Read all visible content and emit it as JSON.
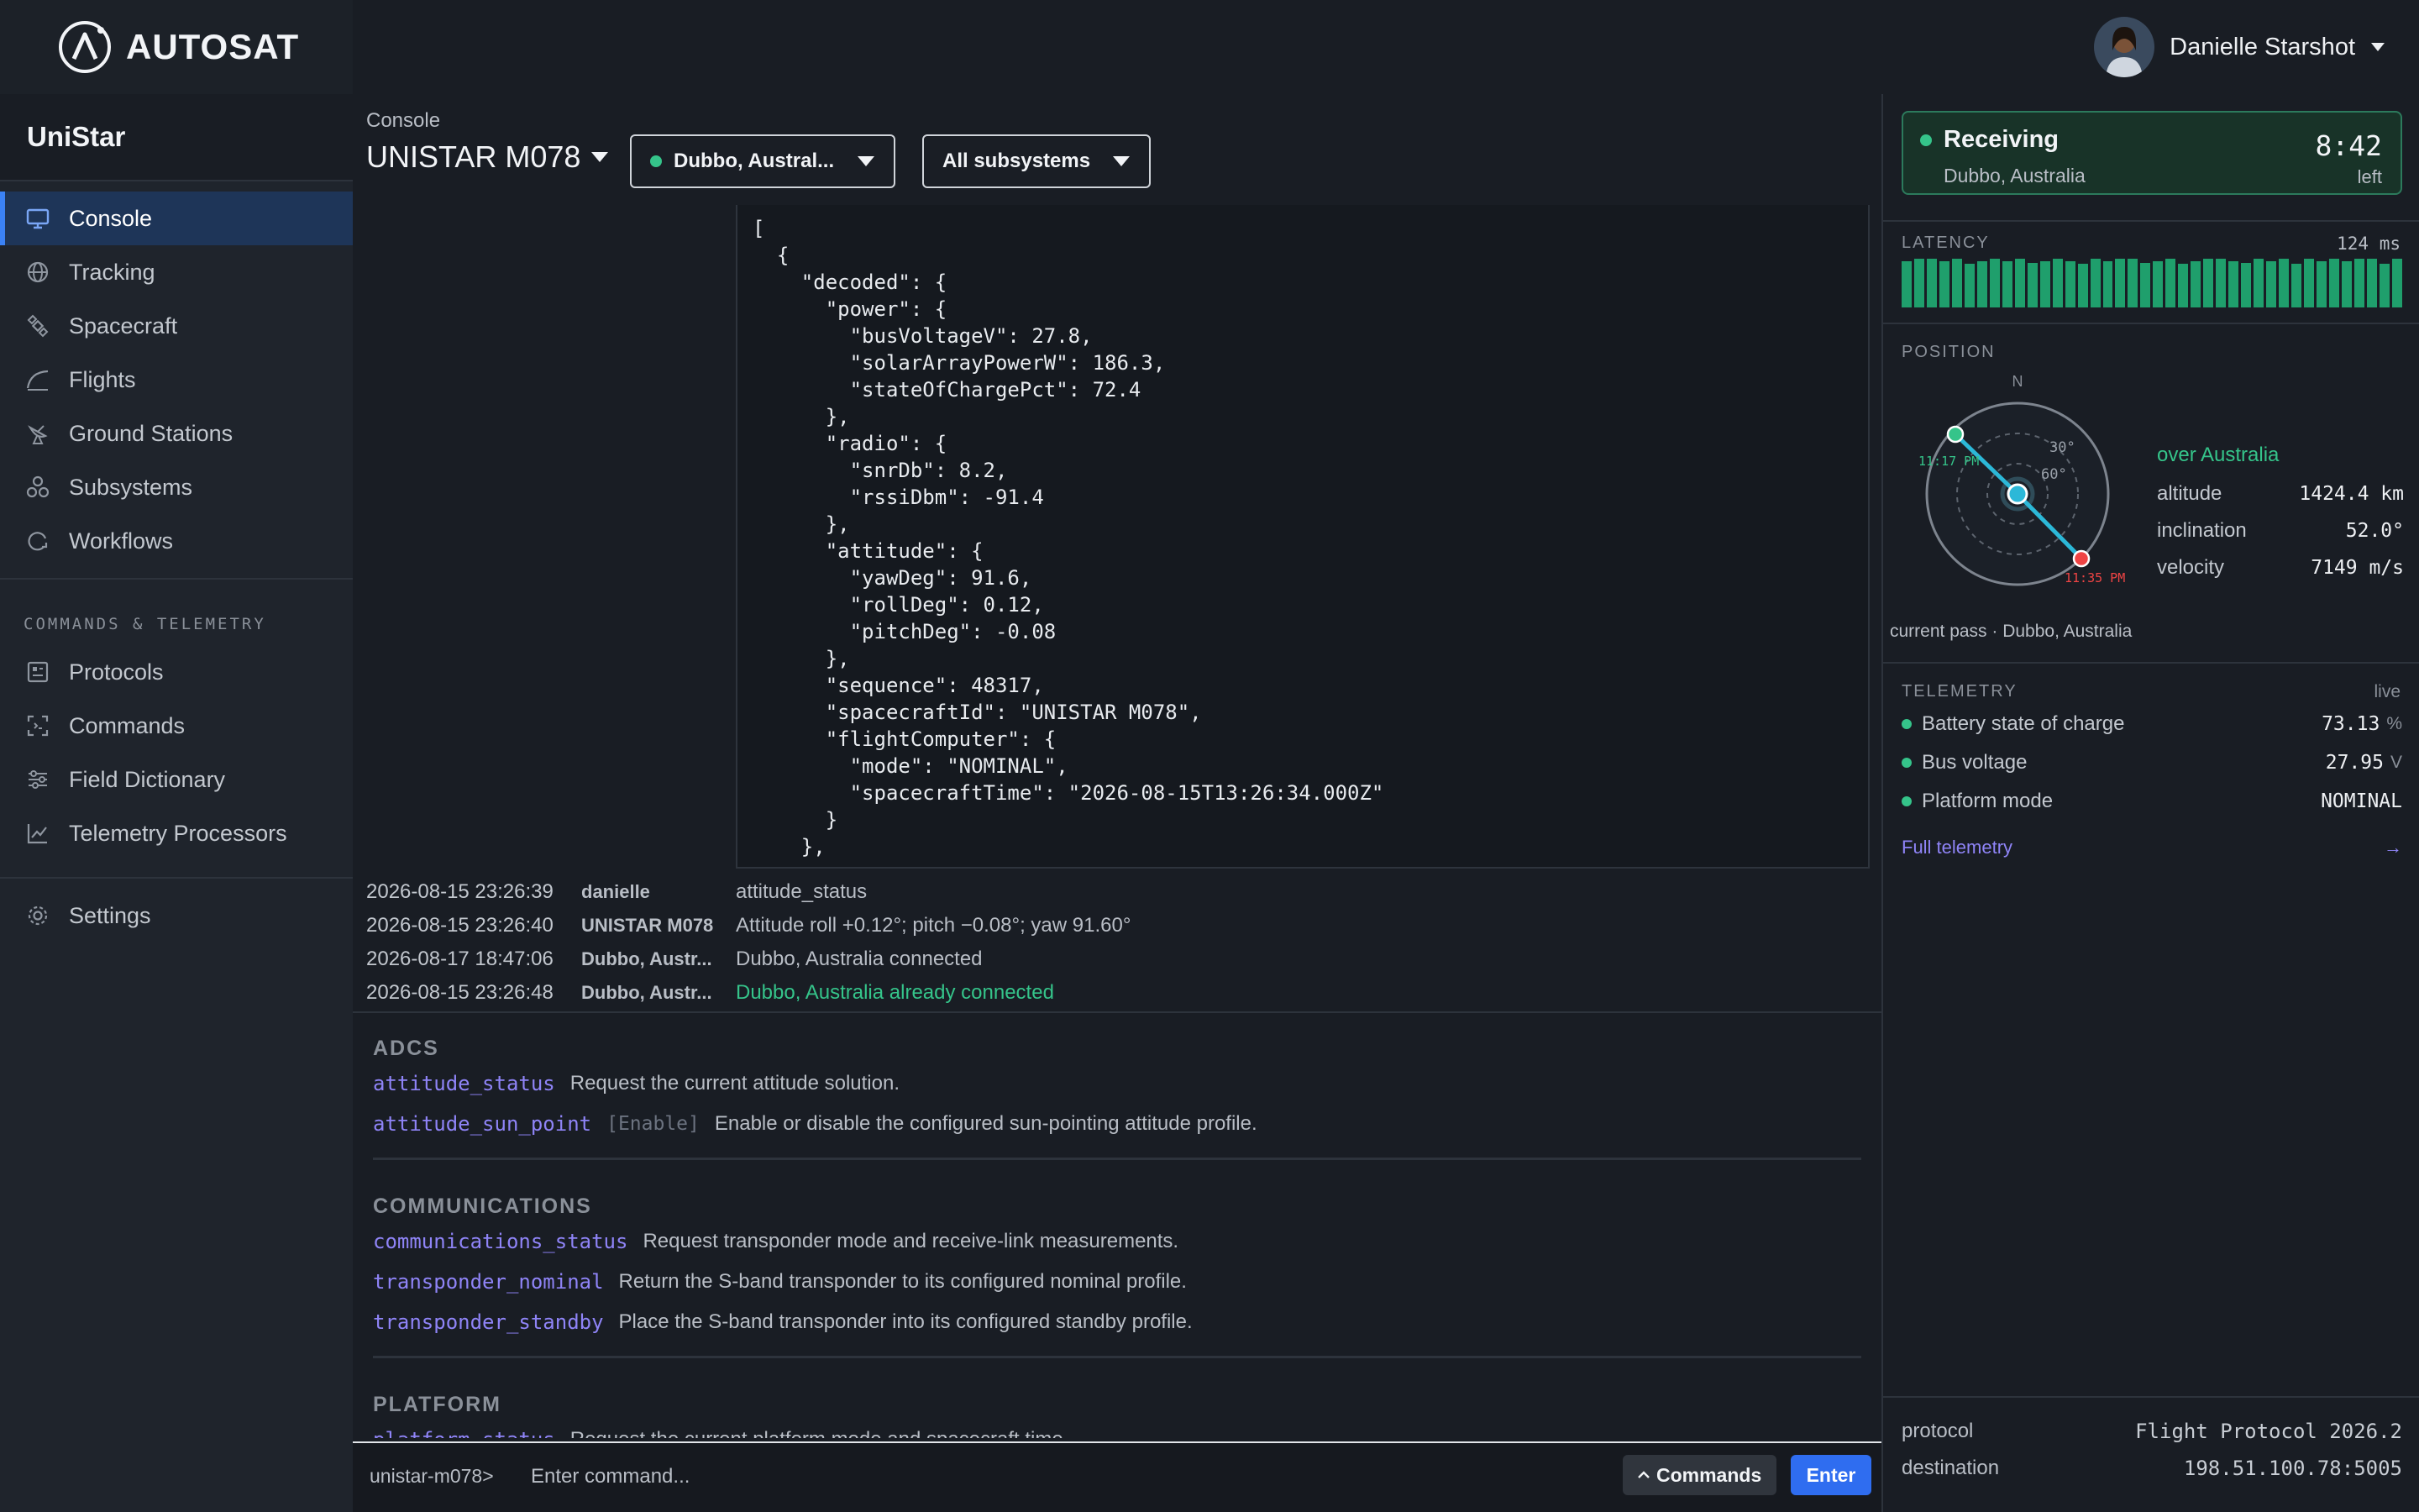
{
  "brand": {
    "name": "AUTOSAT"
  },
  "user": {
    "name": "Danielle Starshot"
  },
  "project": {
    "name": "UniStar"
  },
  "nav": {
    "items": [
      {
        "label": "Console",
        "icon": "monitor-icon",
        "active": true
      },
      {
        "label": "Tracking",
        "icon": "globe-icon"
      },
      {
        "label": "Spacecraft",
        "icon": "satellite-icon"
      },
      {
        "label": "Flights",
        "icon": "flight-path-icon"
      },
      {
        "label": "Ground Stations",
        "icon": "antenna-icon"
      },
      {
        "label": "Subsystems",
        "icon": "subsystems-icon"
      },
      {
        "label": "Workflows",
        "icon": "workflow-icon"
      }
    ],
    "section_label": "COMMANDS & TELEMETRY",
    "section_items": [
      {
        "label": "Protocols",
        "icon": "protocol-icon"
      },
      {
        "label": "Commands",
        "icon": "command-icon"
      },
      {
        "label": "Field Dictionary",
        "icon": "sliders-icon"
      },
      {
        "label": "Telemetry Processors",
        "icon": "chart-icon"
      }
    ],
    "settings": {
      "label": "Settings",
      "icon": "gear-icon"
    }
  },
  "console": {
    "breadcrumb": "Console",
    "spacecraft": "UNISTAR M078",
    "station_filter": "Dubbo, Austral...",
    "subsystem_filter": "All subsystems",
    "json_lines": [
      "[",
      "  {",
      "    \"decoded\": {",
      "      \"power\": {",
      "        \"busVoltageV\": 27.8,",
      "        \"solarArrayPowerW\": 186.3,",
      "        \"stateOfChargePct\": 72.4",
      "      },",
      "      \"radio\": {",
      "        \"snrDb\": 8.2,",
      "        \"rssiDbm\": -91.4",
      "      },",
      "      \"attitude\": {",
      "        \"yawDeg\": 91.6,",
      "        \"rollDeg\": 0.12,",
      "        \"pitchDeg\": -0.08",
      "      },",
      "      \"sequence\": 48317,",
      "      \"spacecraftId\": \"UNISTAR M078\",",
      "      \"flightComputer\": {",
      "        \"mode\": \"NOMINAL\",",
      "        \"spacecraftTime\": \"2026-08-15T13:26:34.000Z\"",
      "      }",
      "    },"
    ],
    "log": [
      {
        "ts": "2026-08-15 23:26:39",
        "who": "danielle",
        "msg": "attitude_status",
        "ok": false
      },
      {
        "ts": "2026-08-15 23:26:40",
        "who": "UNISTAR M078",
        "msg": "Attitude roll +0.12°; pitch −0.08°; yaw 91.60°",
        "ok": false
      },
      {
        "ts": "2026-08-17 18:47:06",
        "who": "Dubbo, Austr...",
        "msg": "Dubbo, Australia connected",
        "ok": false
      },
      {
        "ts": "2026-08-15 23:26:48",
        "who": "Dubbo, Austr...",
        "msg": "Dubbo, Australia already connected",
        "ok": true
      }
    ],
    "groups": [
      {
        "title": "ADCS",
        "commands": [
          {
            "name": "attitude_status",
            "arg": "",
            "desc": "Request the current attitude solution."
          },
          {
            "name": "attitude_sun_point",
            "arg": "[Enable]",
            "desc": "Enable or disable the configured sun-pointing attitude profile."
          }
        ]
      },
      {
        "title": "COMMUNICATIONS",
        "commands": [
          {
            "name": "communications_status",
            "arg": "",
            "desc": "Request transponder mode and receive-link measurements."
          },
          {
            "name": "transponder_nominal",
            "arg": "",
            "desc": "Return the S-band transponder to its configured nominal profile."
          },
          {
            "name": "transponder_standby",
            "arg": "",
            "desc": "Place the S-band transponder into its configured standby profile."
          }
        ]
      },
      {
        "title": "PLATFORM",
        "commands": [
          {
            "name": "platform_status",
            "arg": "",
            "desc": "Request the current platform mode and spacecraft time."
          }
        ]
      }
    ],
    "prompt": "unistar-m078>",
    "input_placeholder": "Enter command...",
    "commands_button": "Commands",
    "enter_button": "Enter"
  },
  "pass": {
    "status": "Receiving",
    "station": "Dubbo, Australia",
    "time_left": "8:42",
    "left_label": "left",
    "status_color": "#35c48a"
  },
  "latency": {
    "label": "LATENCY",
    "value": "124 ms",
    "levels": [
      0.95,
      1,
      1,
      0.95,
      1,
      0.9,
      0.95,
      1,
      0.95,
      1,
      0.92,
      0.95,
      1,
      0.95,
      0.9,
      1,
      0.95,
      1,
      1,
      0.92,
      0.95,
      1,
      0.9,
      0.95,
      1,
      1,
      0.95,
      0.92,
      1,
      0.95,
      1,
      0.9,
      1,
      0.95,
      1,
      0.95,
      1,
      1,
      0.9,
      1
    ],
    "color": "#1f9f6c"
  },
  "position": {
    "label": "POSITION",
    "north": "N",
    "ring_labels": [
      "30°",
      "60°"
    ],
    "aos_time": "11:17 PM",
    "los_time": "11:35 PM",
    "region": "over Australia",
    "rows": [
      {
        "label": "altitude",
        "value": "1424.4 km"
      },
      {
        "label": "inclination",
        "value": "52.0°"
      },
      {
        "label": "velocity",
        "value": "7149 m/s"
      }
    ],
    "caption": "current pass · Dubbo, Australia"
  },
  "telemetry": {
    "label": "TELEMETRY",
    "live": "live",
    "rows": [
      {
        "label": "Battery state of charge",
        "value": "73.13",
        "unit": "%"
      },
      {
        "label": "Bus voltage",
        "value": "27.95",
        "unit": "V"
      },
      {
        "label": "Platform mode",
        "value": "NOMINAL",
        "unit": ""
      }
    ],
    "full_link": "Full telemetry",
    "arrow": "→"
  },
  "link": {
    "rows": [
      {
        "label": "protocol",
        "value": "Flight Protocol 2026.2"
      },
      {
        "label": "destination",
        "value": "198.51.100.78:5005"
      }
    ]
  }
}
